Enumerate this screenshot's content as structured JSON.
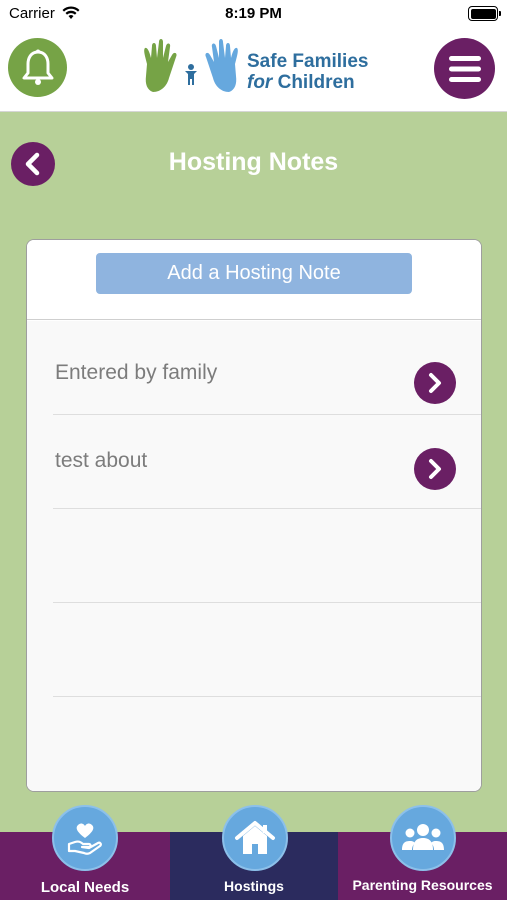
{
  "status_bar": {
    "carrier": "Carrier",
    "time": "8:19 PM"
  },
  "header": {
    "logo": {
      "line1": "Safe Families",
      "line2_prefix": "for",
      "line2_suffix": "Children"
    },
    "bell_icon": "bell-icon",
    "menu_icon": "hamburger-menu-icon"
  },
  "page": {
    "title": "Hosting Notes",
    "back_icon": "chevron-left-icon"
  },
  "card": {
    "add_button_label": "Add a Hosting Note",
    "notes": [
      {
        "label": "Entered by family"
      },
      {
        "label": "test about"
      },
      {
        "label": ""
      },
      {
        "label": ""
      }
    ]
  },
  "tab_bar": {
    "tabs": [
      {
        "label": "Local Needs",
        "icon": "heart-hand-icon"
      },
      {
        "label": "Hostings",
        "icon": "house-icon",
        "active": true
      },
      {
        "label": "Parenting Resources",
        "icon": "group-icon"
      }
    ]
  },
  "colors": {
    "background": "#b7d098",
    "purple": "#6a1f64",
    "green": "#76a346",
    "button_blue": "#8fb4df",
    "tab_active": "#2b2b5e",
    "tab_icon": "#66a8de"
  }
}
